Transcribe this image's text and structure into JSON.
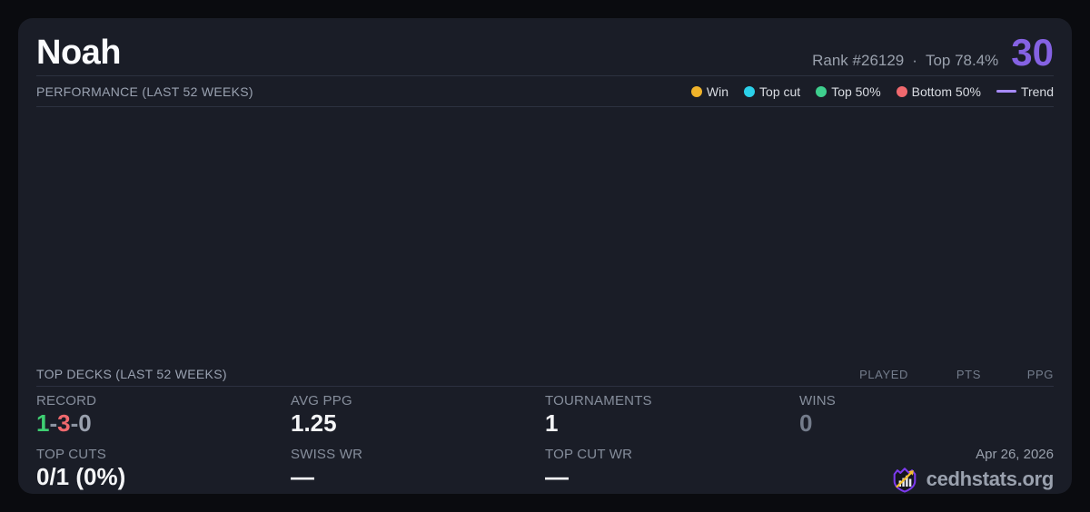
{
  "header": {
    "player_name": "Noah",
    "rank_label": "Rank #26129",
    "separator": "·",
    "top_label": "Top 78.4%",
    "score": "30"
  },
  "performance": {
    "title": "PERFORMANCE (LAST 52 WEEKS)",
    "legend": [
      {
        "label": "Win",
        "color": "#f0b32a",
        "shape": "dot"
      },
      {
        "label": "Top cut",
        "color": "#2bd0e9",
        "shape": "dot"
      },
      {
        "label": "Top 50%",
        "color": "#3ecf8e",
        "shape": "dot"
      },
      {
        "label": "Bottom 50%",
        "color": "#f0696e",
        "shape": "dot"
      },
      {
        "label": "Trend",
        "color": "#a78bfa",
        "shape": "line"
      }
    ]
  },
  "chart_data": {
    "type": "scatter",
    "title": "PERFORMANCE (LAST 52 WEEKS)",
    "series": [
      {
        "name": "Win",
        "points": []
      },
      {
        "name": "Top cut",
        "points": []
      },
      {
        "name": "Top 50%",
        "points": []
      },
      {
        "name": "Bottom 50%",
        "points": []
      },
      {
        "name": "Trend",
        "points": []
      }
    ]
  },
  "top_decks": {
    "title": "TOP DECKS (LAST 52 WEEKS)",
    "columns": [
      "PLAYED",
      "PTS",
      "PPG"
    ],
    "rows": []
  },
  "stats": {
    "record": {
      "label": "RECORD",
      "wins": "1",
      "losses": "3",
      "draws": "0",
      "dash": "-"
    },
    "avg_ppg": {
      "label": "AVG PPG",
      "value": "1.25"
    },
    "tournaments": {
      "label": "TOURNAMENTS",
      "value": "1"
    },
    "wins": {
      "label": "WINS",
      "value": "0"
    },
    "top_cuts": {
      "label": "TOP CUTS",
      "value": "0/1 (0%)"
    },
    "swiss_wr": {
      "label": "SWISS WR",
      "value": "—"
    },
    "top_cut_wr": {
      "label": "TOP CUT WR",
      "value": "—"
    }
  },
  "footer": {
    "date": "Apr 26, 2026",
    "brand": "cedhstats.org"
  },
  "colors": {
    "page_bg": "#0a0b0f",
    "card_bg": "#1a1d27",
    "divider": "#2c3140",
    "accent_purple": "#8562e3",
    "win_green": "#3ecf72",
    "loss_red": "#f0696e",
    "dash_gray": "#8b93a1",
    "draw_gray": "#9aa1ae",
    "dim_value": "#747c8b",
    "logo_purple": "#7c3aed",
    "logo_gold": "#f5c02c"
  }
}
